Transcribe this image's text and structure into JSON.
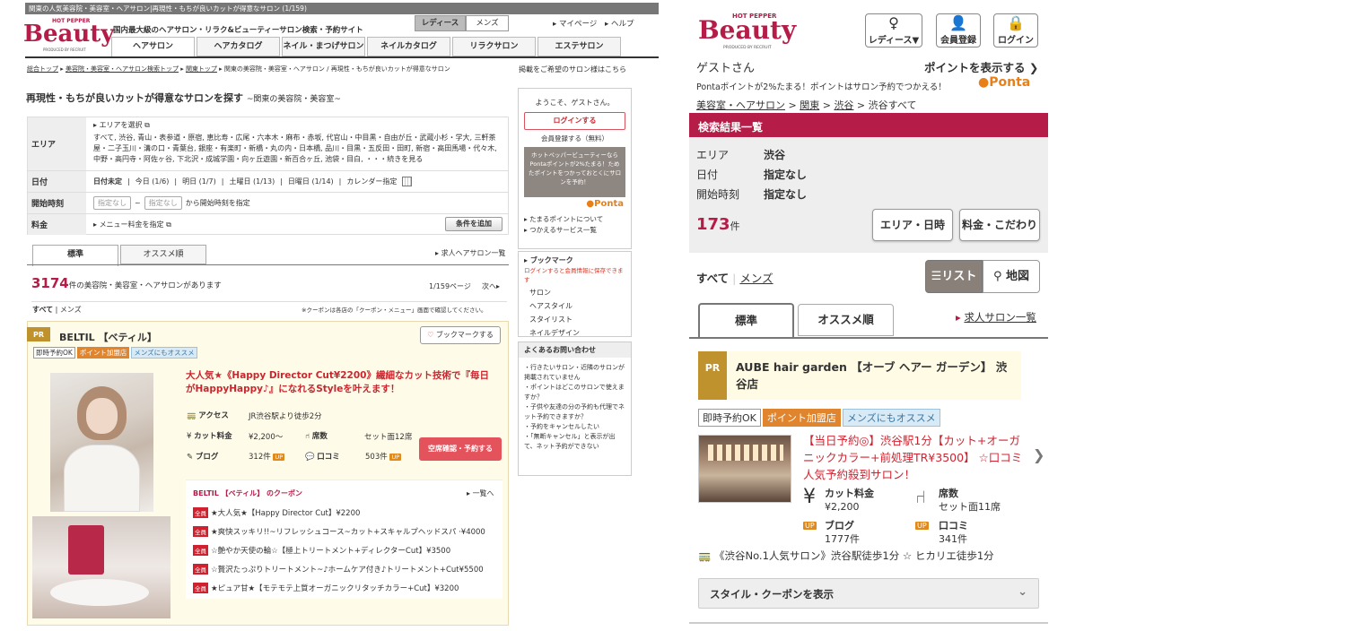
{
  "pc": {
    "top_strip": "関東の人気美容院・美容室・ヘアサロン|再現性・もちが良いカットが得意なサロン (1/159)",
    "logo": {
      "hot_pepper": "HOT PEPPER",
      "beauty": "Beauty",
      "produced_by": "PRODUCED BY RECRUIT"
    },
    "tagline": "国内最大級のヘアサロン・リラク&ビューティーサロン検索・予約サイト",
    "gender_tabs": [
      "レディース",
      "メンズ"
    ],
    "header_links": [
      "マイページ",
      "ヘルプ"
    ],
    "nav_tabs": [
      "ヘアサロン",
      "ヘアカタログ",
      "ネイル・まつげサロン",
      "ネイルカタログ",
      "リラクサロン",
      "エステサロン"
    ],
    "breadcrumb": [
      "総合トップ",
      "美容院・美容室・ヘアサロン検索トップ",
      "関東トップ",
      "関東の美容院・美容室・ヘアサロン / 再現性・もちが良いカットが得意なサロン"
    ],
    "breadcrumb_right": "掲載をご希望のサロン様はこちら",
    "page_title": "再現性・もちが良いカットが得意なサロンを探す",
    "page_title_sub": "~関東の美容院・美容室~",
    "search": {
      "area_label": "エリア",
      "area_select": "エリアを選択",
      "area_text": "すべて, 渋谷, 青山・表参道・原宿, 恵比寿・広尾・六本木・麻布・赤坂, 代官山・中目黒・自由が丘・武蔵小杉・学大, 三軒茶屋・二子玉川・溝の口・青葉台, 銀座・有楽町・新橋・丸の内・日本橋, 品川・目黒・五反田・田町, 新宿・高田馬場・代々木, 中野・高円寺・阿佐ヶ谷, 下北沢・成城学園・向ヶ丘遊園・新百合ヶ丘, 池袋・目白, ・・・続きを見る",
      "date_label": "日付",
      "date_options": [
        "日付未定",
        "今日 (1/6)",
        "明日 (1/7)",
        "土曜日 (1/13)",
        "日曜日 (1/14)",
        "カレンダー指定"
      ],
      "time_label": "開始時刻",
      "time_from": "指定なし",
      "time_to": "指定なし",
      "time_suffix": "から開始時刻を指定",
      "price_label": "料金",
      "price_select": "メニュー料金を指定",
      "add_condition": "条件を追加"
    },
    "sort_tabs": [
      "標準",
      "オススメ順"
    ],
    "job_link": "求人ヘアサロン一覧",
    "result_count": "3174",
    "result_text": "件の美容院・美容室・ヘアサロンがあります",
    "pager": "1/159ページ",
    "next": "次へ",
    "filter": [
      "すべて",
      "メンズ"
    ],
    "coupon_note": "※クーポンは各店の「クーポン・メニュー」画面で確認してください。",
    "salon": {
      "pr": "PR",
      "name": "BELTIL 【ベティル】",
      "bookmark": "ブックマークする",
      "tags": [
        "即時予約OK",
        "ポイント加盟店",
        "メンズにもオススメ"
      ],
      "catch": "大人気★《Happy Director Cut¥2200》繊細なカット技術で『毎日がHappyHappy♪』になれるStyleを叶えます！",
      "access_label": "アクセス",
      "access": "JR渋谷駅より徒歩2分",
      "cut_label": "カット料金",
      "cut": "¥2,200～",
      "seat_label": "席数",
      "seats": "セット面12席",
      "blog_label": "ブログ",
      "blog": "312件",
      "review_label": "口コミ",
      "reviews": "503件",
      "reserve_btn": "空席確認・予約する",
      "coupon_title": "BELTIL 【ベティル】 のクーポン",
      "coupon_all": "一覧へ",
      "coupon_badge": "全員",
      "coupons": [
        "★大人気★【Happy Director Cut】¥2200",
        "★爽快スッキリ!!~リフレッシュコース~カット+スキャルプヘッドスパ ·¥4000",
        "☆艶やか天使の輪☆【極上トリートメント+ディレクターCut】¥3500",
        "☆贅沢たっぷりトリートメント~♪ホームケア付き♪トリートメント+Cut¥5500",
        "★ピュア甘★【モテモテ上質オーガニックリタッチカラー+Cut】¥3200"
      ]
    },
    "side": {
      "welcome": "ようこそ、ゲストさん。",
      "login": "ログインする",
      "register": "会員登録する（無料）",
      "promo": "ホットペッパービューティーならPontaポイントが2%たまる！ためたポイントをつかっておとくにサロンを予約！",
      "ponta": "Ponta",
      "links": [
        "たまるポイントについて",
        "つかえるサービス一覧"
      ],
      "bookmark_title": "ブックマーク",
      "bookmark_note": "ログインすると会員情報に保存できます",
      "bookmark_items": [
        "サロン",
        "ヘアスタイル",
        "スタイリスト",
        "ネイルデザイン"
      ],
      "faq_title": "よくあるお問い合わせ",
      "faq": [
        "行きたいサロン・近隣のサロンが掲載されていません",
        "ポイントはどこのサロンで使えますか？",
        "子供や友達の分の予約も代理でネット予約できますか？",
        "予約をキャンセルしたい",
        "「無断キャンセル」と表示が出て、ネット予約ができない"
      ]
    }
  },
  "sp": {
    "logo": {
      "hot_pepper": "HOT PEPPER",
      "beauty": "Beauty",
      "produced_by": "PRODUCED BY RECRUIT"
    },
    "header_buttons": [
      "レディース▼",
      "会員登録",
      "ログイン"
    ],
    "guest": "ゲストさん",
    "show_points": "ポイントを表示する",
    "ponta_note": "Pontaポイントが2%たまる！ポイントはサロン予約でつかえる！",
    "ponta": "Ponta",
    "breadcrumb": [
      "美容室・ヘアサロン",
      "関東",
      "渋谷",
      "渋谷すべて"
    ],
    "result_title": "検索結果一覧",
    "conditions": [
      {
        "label": "エリア",
        "value": "渋谷"
      },
      {
        "label": "日付",
        "value": "指定なし"
      },
      {
        "label": "開始時刻",
        "value": "指定なし"
      }
    ],
    "count": "173",
    "count_unit": "件",
    "btn_area": "エリア・日時",
    "btn_price": "料金・こだわり",
    "filter_all": "すべて",
    "filter_men": "メンズ",
    "view_list": "リスト",
    "view_map": "地図",
    "sort_tabs": [
      "標準",
      "オススメ順"
    ],
    "job_link": "求人サロン一覧",
    "salon": {
      "pr": "PR",
      "name": "AUBE hair garden 【オーブ ヘアー ガーデン】 渋谷店",
      "tags": [
        "即時予約OK",
        "ポイント加盟店",
        "メンズにもオススメ"
      ],
      "catch": "【当日予約◎】渋谷駅1分【カット+オーガニックカラー+前処理TR¥3500】 ☆口コミ人気予約殺到サロン！",
      "cut_label": "カット料金",
      "cut": "¥2,200",
      "seat_label": "席数",
      "seats": "セット面11席",
      "blog_label": "ブログ",
      "blog": "1777件",
      "review_label": "口コミ",
      "reviews": "341件",
      "access": "《渋谷No.1人気サロン》渋谷駅徒歩1分 ☆ ヒカリエ徒歩1分",
      "expand": "スタイル・クーポンを表示"
    }
  },
  "colors": {
    "brand": "#b51c47",
    "ponta": "#e8801a",
    "pr": "#c0922e"
  }
}
